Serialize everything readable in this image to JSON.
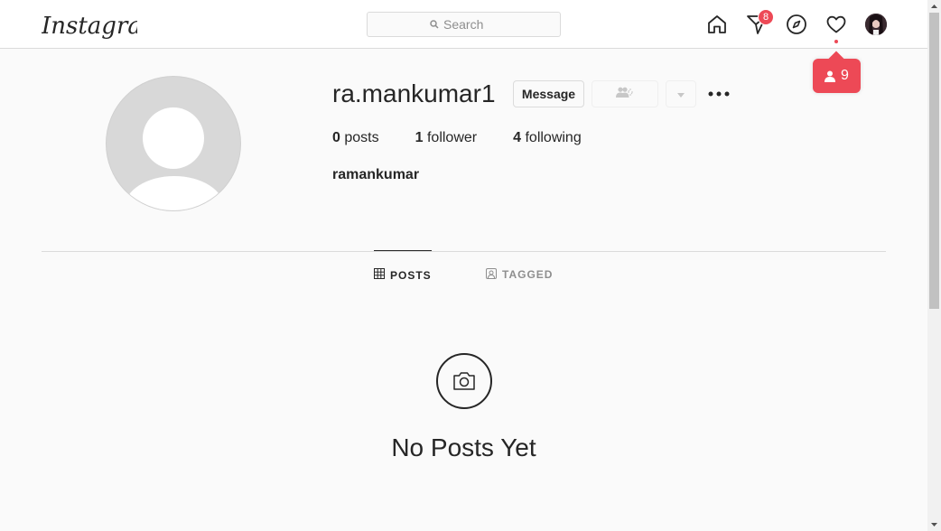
{
  "app": {
    "logo_text": "Instagram"
  },
  "search": {
    "placeholder": "Search"
  },
  "nav": {
    "home_icon": "home-icon",
    "direct_icon": "direct-paper-plane-icon",
    "direct_badge": "8",
    "explore_icon": "compass-icon",
    "activity_icon": "heart-icon",
    "avatar_icon": "user-avatar-thumbnail"
  },
  "activity_tooltip": {
    "icon": "person-icon",
    "count": "9"
  },
  "profile": {
    "username": "ra.mankumar1",
    "message_label": "Message",
    "follow_icon": "follow-person-icon",
    "dropdown_icon": "caret-down-icon",
    "options_icon": "more-options-icon",
    "stats": [
      {
        "value": "0",
        "label": "posts"
      },
      {
        "value": "1",
        "label": "follower"
      },
      {
        "value": "4",
        "label": "following"
      }
    ],
    "full_name": "ramankumar"
  },
  "tabs": [
    {
      "label": "POSTS",
      "icon": "grid-icon",
      "active": true
    },
    {
      "label": "TAGGED",
      "icon": "tagged-icon",
      "active": false
    }
  ],
  "empty_state": {
    "icon": "camera-icon",
    "title": "No Posts Yet"
  },
  "colors": {
    "badge": "#ed4956",
    "text": "#262626",
    "muted": "#8e8e8e",
    "border": "#dbdbdb",
    "background": "#fafafa"
  }
}
